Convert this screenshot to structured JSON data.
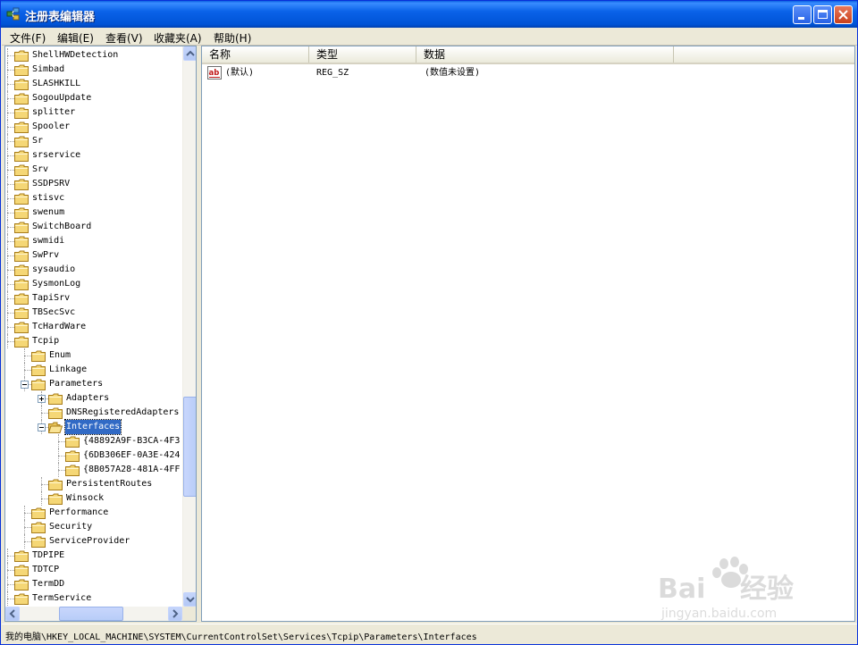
{
  "window": {
    "title": "注册表编辑器"
  },
  "menu": [
    "文件(F)",
    "编辑(E)",
    "查看(V)",
    "收藏夹(A)",
    "帮助(H)"
  ],
  "tree": {
    "items": [
      {
        "label": "ShellHWDetection",
        "level": 0,
        "expander": "none"
      },
      {
        "label": "Simbad",
        "level": 0,
        "expander": "none"
      },
      {
        "label": "SLASHKILL",
        "level": 0,
        "expander": "none"
      },
      {
        "label": "SogouUpdate",
        "level": 0,
        "expander": "none"
      },
      {
        "label": "splitter",
        "level": 0,
        "expander": "none"
      },
      {
        "label": "Spooler",
        "level": 0,
        "expander": "none"
      },
      {
        "label": "Sr",
        "level": 0,
        "expander": "none"
      },
      {
        "label": "srservice",
        "level": 0,
        "expander": "none"
      },
      {
        "label": "Srv",
        "level": 0,
        "expander": "none"
      },
      {
        "label": "SSDPSRV",
        "level": 0,
        "expander": "none"
      },
      {
        "label": "stisvc",
        "level": 0,
        "expander": "none"
      },
      {
        "label": "swenum",
        "level": 0,
        "expander": "none"
      },
      {
        "label": "SwitchBoard",
        "level": 0,
        "expander": "none"
      },
      {
        "label": "swmidi",
        "level": 0,
        "expander": "none"
      },
      {
        "label": "SwPrv",
        "level": 0,
        "expander": "none"
      },
      {
        "label": "sysaudio",
        "level": 0,
        "expander": "none"
      },
      {
        "label": "SysmonLog",
        "level": 0,
        "expander": "none"
      },
      {
        "label": "TapiSrv",
        "level": 0,
        "expander": "none"
      },
      {
        "label": "TBSecSvc",
        "level": 0,
        "expander": "none"
      },
      {
        "label": "TcHardWare",
        "level": 0,
        "expander": "none"
      },
      {
        "label": "Tcpip",
        "level": 0,
        "expander": "none"
      },
      {
        "label": "Enum",
        "level": 1,
        "expander": "none"
      },
      {
        "label": "Linkage",
        "level": 1,
        "expander": "none"
      },
      {
        "label": "Parameters",
        "level": 1,
        "expander": "minus"
      },
      {
        "label": "Adapters",
        "level": 2,
        "expander": "plus"
      },
      {
        "label": "DNSRegisteredAdapters",
        "level": 2,
        "expander": "none"
      },
      {
        "label": "Interfaces",
        "level": 2,
        "expander": "minus",
        "selected": true
      },
      {
        "label": "{48892A9F-B3CA-4F3",
        "level": 3,
        "expander": "none"
      },
      {
        "label": "{6DB306EF-0A3E-424",
        "level": 3,
        "expander": "none"
      },
      {
        "label": "{8B057A28-481A-4FF",
        "level": 3,
        "expander": "none"
      },
      {
        "label": "PersistentRoutes",
        "level": 2,
        "expander": "none"
      },
      {
        "label": "Winsock",
        "level": 2,
        "expander": "none"
      },
      {
        "label": "Performance",
        "level": 1,
        "expander": "none"
      },
      {
        "label": "Security",
        "level": 1,
        "expander": "none"
      },
      {
        "label": "ServiceProvider",
        "level": 1,
        "expander": "none"
      },
      {
        "label": "TDPIPE",
        "level": 0,
        "expander": "none"
      },
      {
        "label": "TDTCP",
        "level": 0,
        "expander": "none"
      },
      {
        "label": "TermDD",
        "level": 0,
        "expander": "none"
      },
      {
        "label": "TermService",
        "level": 0,
        "expander": "none"
      }
    ]
  },
  "list": {
    "columns": [
      "名称",
      "类型",
      "数据"
    ],
    "rows": [
      {
        "name": "(默认)",
        "type": "REG_SZ",
        "data": "(数值未设置)",
        "icon": "string-value-icon"
      }
    ]
  },
  "status": {
    "path": "我的电脑\\HKEY_LOCAL_MACHINE\\SYSTEM\\CurrentControlSet\\Services\\Tcpip\\Parameters\\Interfaces"
  },
  "colors": {
    "titlebar": "#0053d6",
    "selection": "#316ac5",
    "folder": "#f5d776"
  },
  "watermark": {
    "brand": "Baidu 经验",
    "url": "jingyan.baidu.com"
  }
}
